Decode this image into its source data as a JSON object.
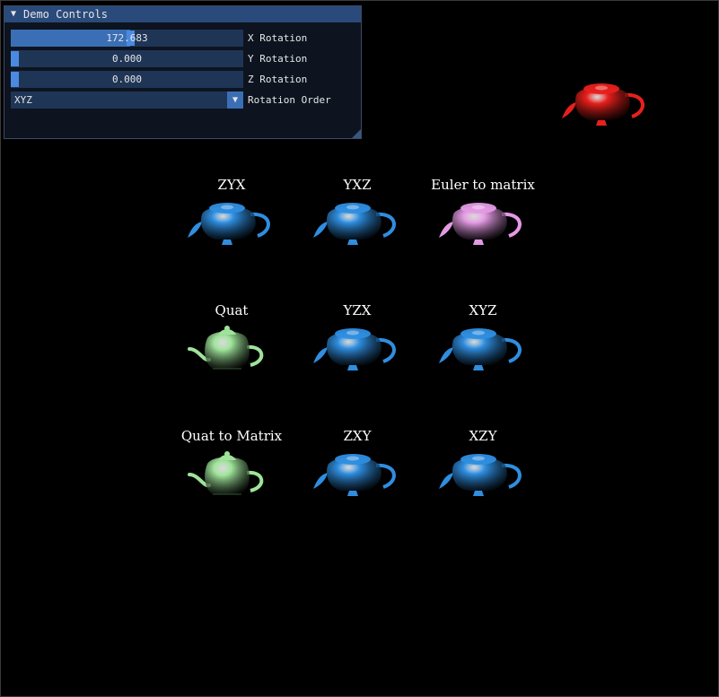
{
  "panel": {
    "title": "Demo Controls",
    "sliders": [
      {
        "label": "X Rotation",
        "value": "172.683",
        "fraction": 0.515
      },
      {
        "label": "Y Rotation",
        "value": "0.000",
        "fraction": 0.0
      },
      {
        "label": "Z Rotation",
        "value": "0.000",
        "fraction": 0.0
      }
    ],
    "rotation_order": {
      "label": "Rotation Order",
      "value": "XYZ"
    }
  },
  "grid": [
    {
      "caption": "ZYX",
      "color": "#2f8ee0",
      "style": "rotated"
    },
    {
      "caption": "YXZ",
      "color": "#2f8ee0",
      "style": "rotated"
    },
    {
      "caption": "Euler to matrix",
      "color": "#e39ae3",
      "style": "rotated"
    },
    {
      "caption": "Quat",
      "color": "#9fe39a",
      "style": "upright"
    },
    {
      "caption": "YZX",
      "color": "#2f8ee0",
      "style": "rotated"
    },
    {
      "caption": "XYZ",
      "color": "#2f8ee0",
      "style": "rotated"
    },
    {
      "caption": "Quat to Matrix",
      "color": "#9fe39a",
      "style": "upright"
    },
    {
      "caption": "ZXY",
      "color": "#2f8ee0",
      "style": "rotated"
    },
    {
      "caption": "XZY",
      "color": "#2f8ee0",
      "style": "rotated"
    }
  ],
  "reference_teapot": {
    "color": "#e8201c",
    "style": "rotated"
  },
  "icons": {
    "collapse": "collapse-triangle-icon",
    "dropdown": "dropdown-arrow-icon"
  }
}
